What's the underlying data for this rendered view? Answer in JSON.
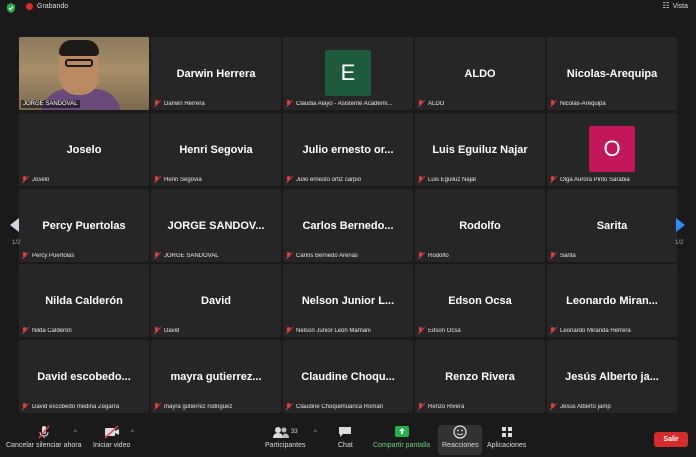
{
  "topbar": {
    "recording_label": "Grabando",
    "view_label": "Vista"
  },
  "self_tile": {
    "name": "JORGE SANDOVAL"
  },
  "participants": [
    {
      "title": "Darwin Herrera",
      "name": "Darwin Herrera"
    },
    {
      "avatar_letter": "E",
      "avatar_color": "#1e5a3c",
      "name": "Claudia Alayo - Asistente Académi..."
    },
    {
      "title": "ALDO",
      "name": "ALDO"
    },
    {
      "title": "Nicolas-Arequipa",
      "name": "Nicolas-Arequipa"
    },
    {
      "title": "Joselo",
      "name": "Joselo"
    },
    {
      "title": "Henri Segovia",
      "name": "Henri Segovia"
    },
    {
      "title": "Julio ernesto or...",
      "name": "Julio ernesto ortiz carpio"
    },
    {
      "title": "Luis Eguiluz Najar",
      "name": "Luis Eguiluz Najar"
    },
    {
      "avatar_letter": "O",
      "avatar_color": "#c2185b",
      "name": "Olga Aurora Pinto Sarabia"
    },
    {
      "title": "Percy Puertolas",
      "name": "Percy Puertolas"
    },
    {
      "title": "JORGE SANDOV...",
      "name": "JORGE SANDOVAL"
    },
    {
      "title": "Carlos Bernedo...",
      "name": "Carlos Bernedo Arenas"
    },
    {
      "title": "Rodolfo",
      "name": "Rodolfo"
    },
    {
      "title": "Sarita",
      "name": "Sarita"
    },
    {
      "title": "Nilda Calderón",
      "name": "Nilda Calderón"
    },
    {
      "title": "David",
      "name": "David"
    },
    {
      "title": "Nelson Junior L...",
      "name": "Nelson Junior León Mamani"
    },
    {
      "title": "Edson Ocsa",
      "name": "Edson Ocsa"
    },
    {
      "title": "Leonardo Miran...",
      "name": "Leonardo Miranda Herrera"
    },
    {
      "title": "David escobedo...",
      "name": "David escobedo medina Zegarra"
    },
    {
      "title": "mayra gutierrez...",
      "name": "mayra gutierrez rodriguez"
    },
    {
      "title": "Claudine Choqu...",
      "name": "Claudine Choquehuanca Roman"
    },
    {
      "title": "Renzo Rivera",
      "name": "Renzo Rivera"
    },
    {
      "title": "Jesús Alberto ja...",
      "name": "Jesús Alberto jamp"
    }
  ],
  "pagination": {
    "left": "1/2",
    "right": "1/2"
  },
  "toolbar": {
    "mute_label": "Cancelar silenciar ahora",
    "video_label": "Iniciar video",
    "participants_label": "Participantes",
    "participants_count": "33",
    "chat_label": "Chat",
    "share_label": "Compartir pantalla",
    "reactions_label": "Reacciones",
    "apps_label": "Aplicaciones",
    "leave_label": "Salir"
  }
}
